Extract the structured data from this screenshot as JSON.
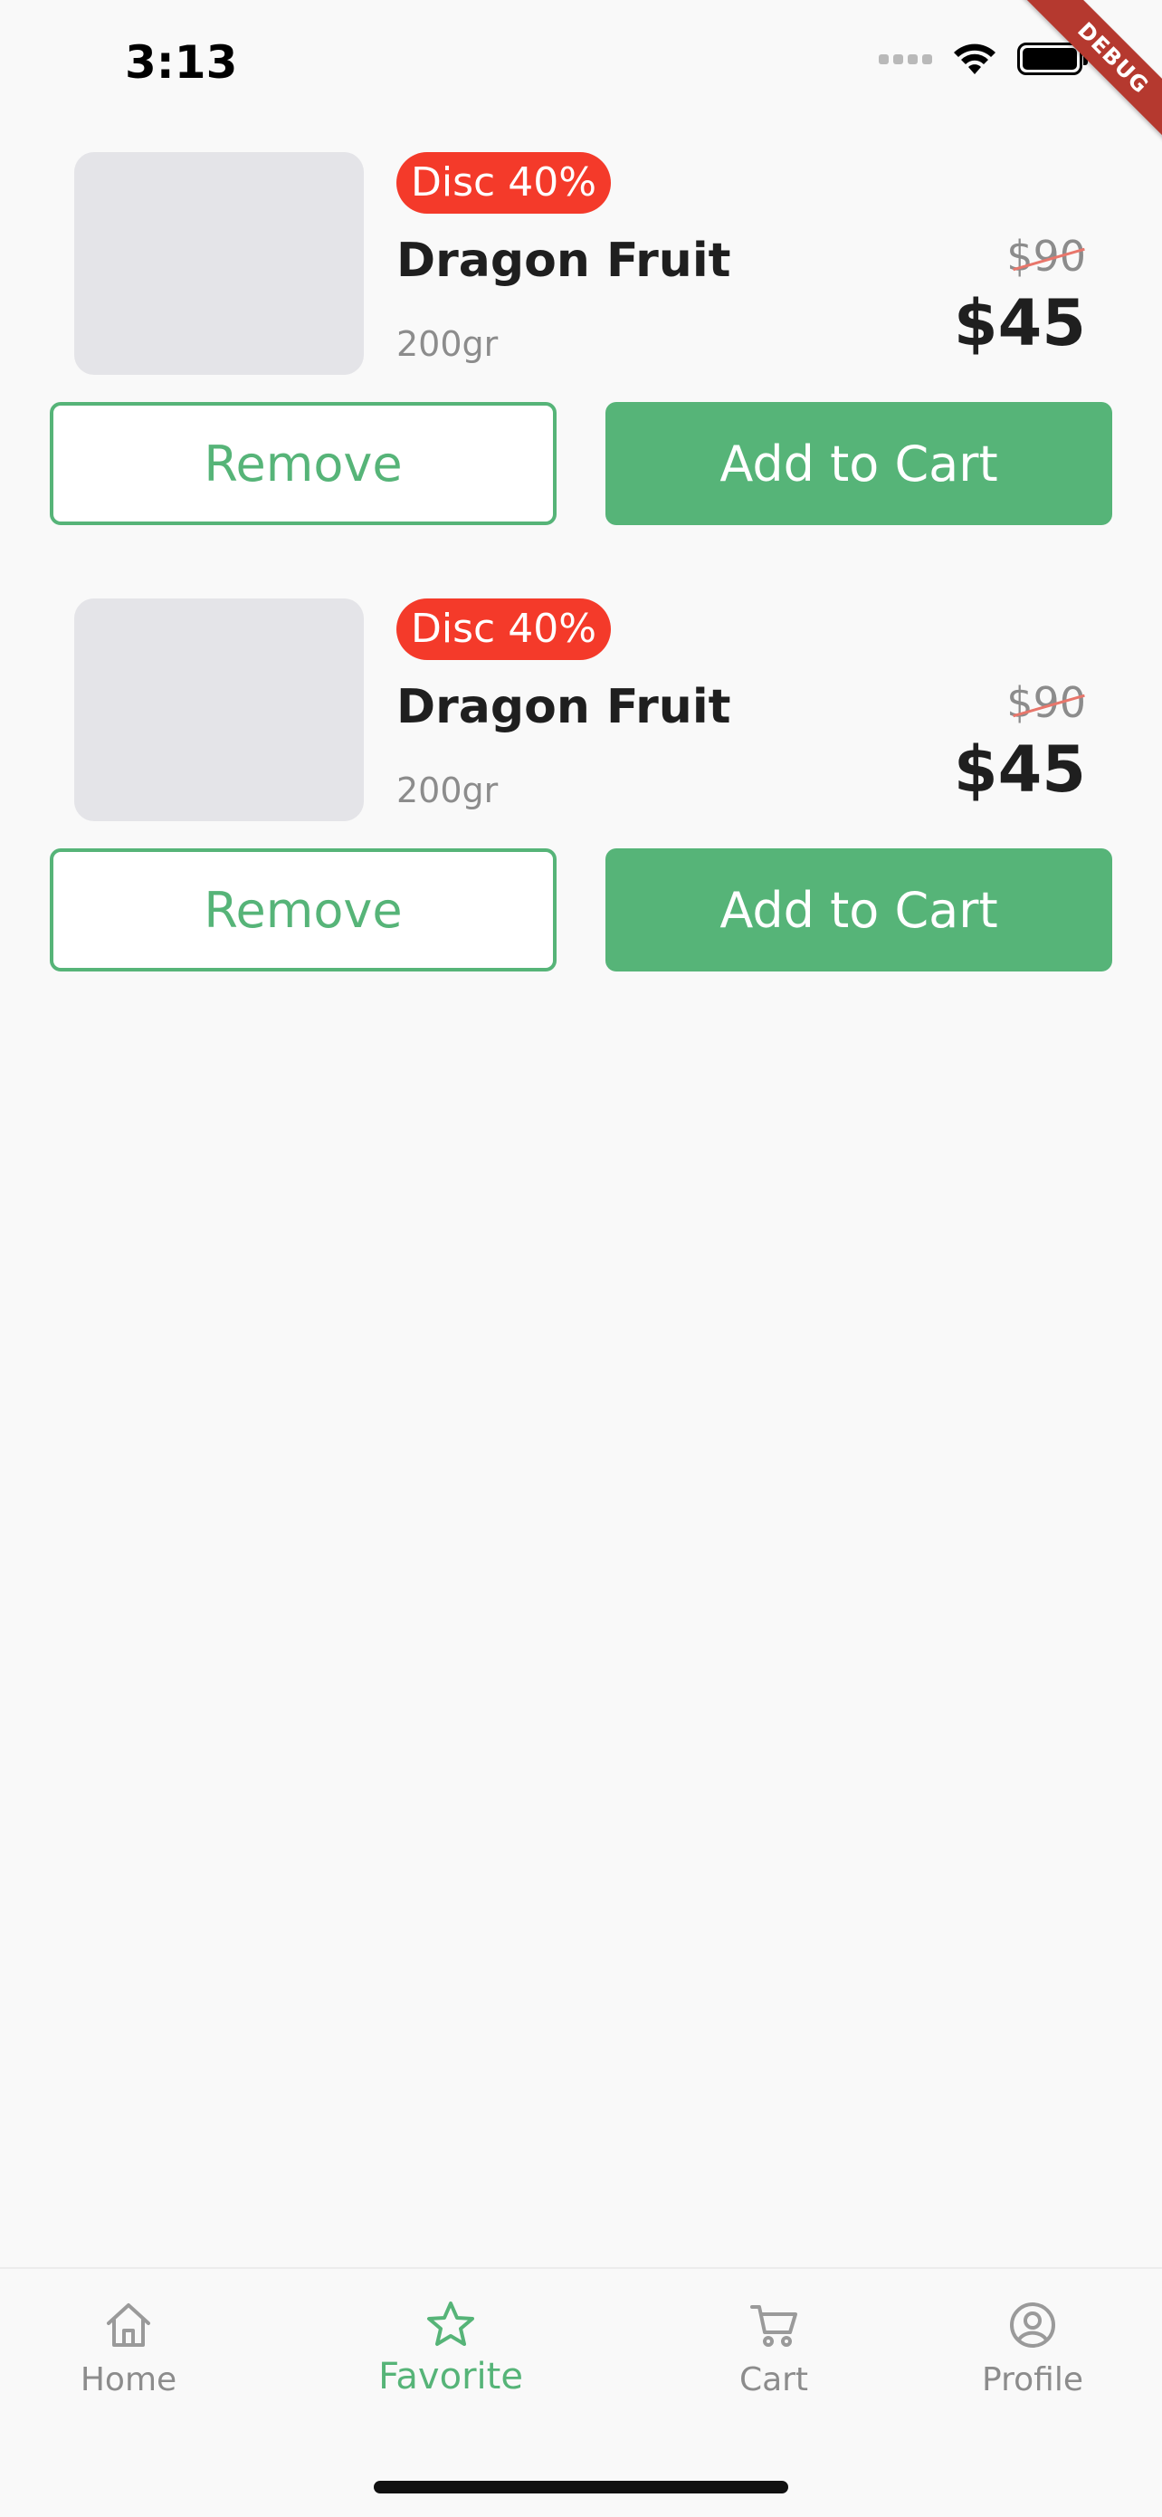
{
  "status_bar": {
    "time": "3:13"
  },
  "debug_banner": "DEBUG",
  "products": [
    {
      "badge": "Disc 40%",
      "name": "Dragon Fruit",
      "weight": "200gr",
      "old_price": "$90",
      "price": "$45",
      "remove_label": "Remove",
      "add_label": "Add to Cart"
    },
    {
      "badge": "Disc 40%",
      "name": "Dragon Fruit",
      "weight": "200gr",
      "old_price": "$90",
      "price": "$45",
      "remove_label": "Remove",
      "add_label": "Add to Cart"
    }
  ],
  "tabbar": {
    "active": "Favorite",
    "items": [
      {
        "label": "Home",
        "icon": "home-icon"
      },
      {
        "label": "Favorite",
        "icon": "star-icon"
      },
      {
        "label": "Cart",
        "icon": "cart-icon"
      },
      {
        "label": "Profile",
        "icon": "profile-icon"
      }
    ]
  },
  "colors": {
    "accent": "#56b478",
    "badge": "#f43a2a",
    "placeholder": "#e4e4e8",
    "background": "#f9f9f9",
    "debug": "#b5392f"
  }
}
